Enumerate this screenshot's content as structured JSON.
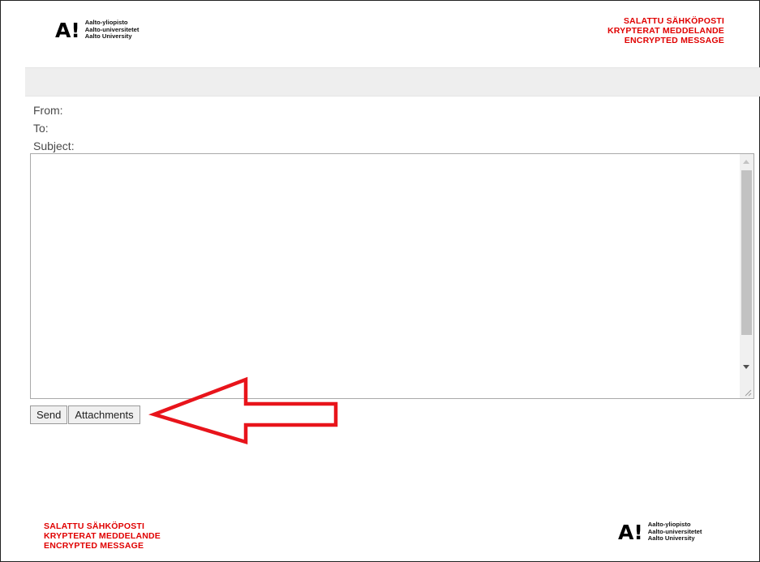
{
  "branding": {
    "logo_mark": "A!",
    "logo_lines": [
      "Aalto-yliopisto",
      "Aalto-universitetet",
      "Aalto University"
    ],
    "banner_lines": [
      "SALATTU SÄHKÖPOSTI",
      "KRYPTERAT MEDDELANDE",
      "ENCRYPTED MESSAGE"
    ],
    "banner_color": "#e00000"
  },
  "message": {
    "from_label": "From:",
    "to_label": "To:",
    "subject_label": "Subject:",
    "body_text": ""
  },
  "actions": {
    "send_label": "Send",
    "attachments_label": "Attachments"
  },
  "annotation": {
    "arrow_color": "#e8141b",
    "points_to": "attachments-button"
  }
}
